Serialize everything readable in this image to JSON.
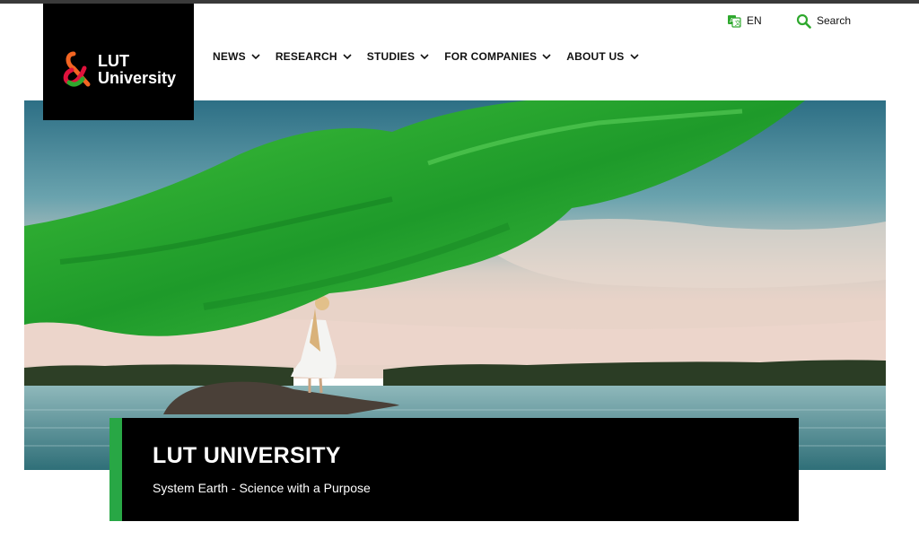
{
  "logo": {
    "line1": "LUT",
    "line2": "University",
    "icon": "lut-ampersand-logo"
  },
  "nav": {
    "items": [
      {
        "label": "NEWS"
      },
      {
        "label": "RESEARCH"
      },
      {
        "label": "STUDIES"
      },
      {
        "label": "FOR COMPANIES"
      },
      {
        "label": "ABOUT US"
      }
    ],
    "chevron_icon": "chevron-down-icon"
  },
  "utility": {
    "language": {
      "label": "EN",
      "icon": "translate-icon"
    },
    "search": {
      "label": "Search",
      "icon": "search-icon"
    }
  },
  "hero": {
    "image": "woman-on-rock-with-green-fabric-over-lake",
    "caption_title": "LUT UNIVERSITY",
    "caption_subtitle": "System Earth - Science with a Purpose"
  },
  "colors": {
    "brand_black": "#000000",
    "accent_green": "#28a745",
    "fabric_green": "#2fa82e",
    "logo_orange": "#f26522",
    "logo_red": "#e0123c"
  }
}
